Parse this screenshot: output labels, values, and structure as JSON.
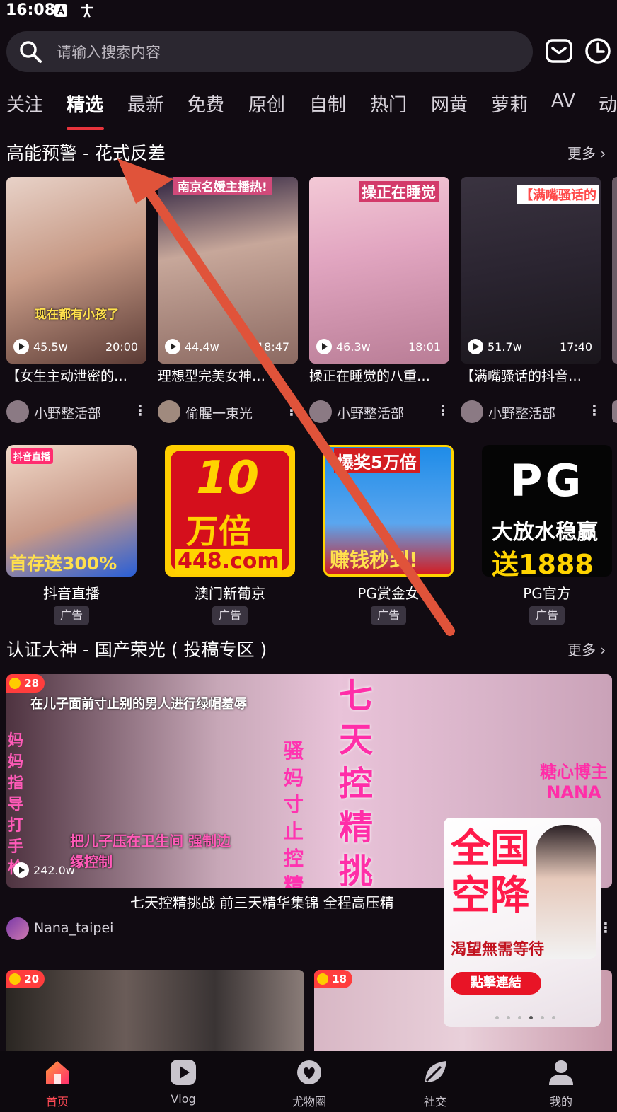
{
  "status_bar": {
    "time": "16:08"
  },
  "search": {
    "placeholder": "请输入搜索内容"
  },
  "tabs": [
    {
      "label": "关注"
    },
    {
      "label": "精选"
    },
    {
      "label": "最新"
    },
    {
      "label": "免费"
    },
    {
      "label": "原创"
    },
    {
      "label": "自制"
    },
    {
      "label": "热门"
    },
    {
      "label": "网黄"
    },
    {
      "label": "萝莉"
    },
    {
      "label": "AV"
    },
    {
      "label": "动"
    }
  ],
  "active_tab": "精选",
  "section1": {
    "title": "高能预警 - 花式反差",
    "more": "更多",
    "videos": [
      {
        "views": "45.5w",
        "duration": "20:00",
        "title": "【女生主动泄密的…",
        "author": "小野整活部",
        "thumb_text": "现在都有小孩了"
      },
      {
        "views": "44.4w",
        "duration": "18:47",
        "title": "理想型完美女神…",
        "author": "偷腥一束光",
        "thumb_text": "南京名媛主播热!"
      },
      {
        "views": "46.3w",
        "duration": "18:01",
        "title": "操正在睡觉的八重…",
        "author": "小野整活部",
        "thumb_text": "操正在睡觉"
      },
      {
        "views": "51.7w",
        "duration": "17:40",
        "title": "【满嘴骚话的抖音…",
        "author": "小野整活部",
        "thumb_text": "【满嘴骚话的"
      }
    ]
  },
  "ads": [
    {
      "name": "抖音直播",
      "badge": "广告",
      "img_top": "抖音直播",
      "img_bottom": "首存送300%"
    },
    {
      "name": "澳门新葡京",
      "badge": "广告",
      "img_top": "10",
      "img_mid": "万倍",
      "img_bottom": "448.com"
    },
    {
      "name": "PG赏金女",
      "badge": "广告",
      "img_top": "爆奖5万倍",
      "img_bottom": "赚钱秒到!"
    },
    {
      "name": "PG官方",
      "badge": "广告",
      "img_top": "PG",
      "img_mid": "大放水稳赢",
      "img_bottom": "送1888"
    }
  ],
  "section2": {
    "title": "认证大神 - 国产荣光 ( 投稿专区 )",
    "more": "更多",
    "feature": {
      "coins": "28",
      "views": "242.0w",
      "title": "七天控精挑战 前三天精华集锦 全程高压精",
      "author": "Nana_taipei",
      "overlay_top": "在儿子面前寸止别的男人进行绿帽羞辱",
      "overlay_left": "妈妈指导打手枪",
      "overlay_mid": "骚妈寸止控精",
      "overlay_big": "七天控精挑战",
      "overlay_right": "糖心博主 NANA",
      "overlay_bottom": "把儿子压在卫生间 强制边缘控制"
    },
    "next_cards": [
      {
        "coins": "20"
      },
      {
        "coins": "18"
      }
    ]
  },
  "floating_ad": {
    "line1": "全国",
    "line2": "空降",
    "line3": "渴望無需等待",
    "button": "點擊連結"
  },
  "bottom_nav": [
    {
      "label": "首页",
      "icon": "home-icon"
    },
    {
      "label": "Vlog",
      "icon": "play-icon"
    },
    {
      "label": "尤物圈",
      "icon": "heart-icon"
    },
    {
      "label": "社交",
      "icon": "leaf-icon"
    },
    {
      "label": "我的",
      "icon": "user-icon"
    }
  ],
  "colors": {
    "accent": "#e8343c",
    "background": "#110b12",
    "search_bg": "#2b2730"
  }
}
